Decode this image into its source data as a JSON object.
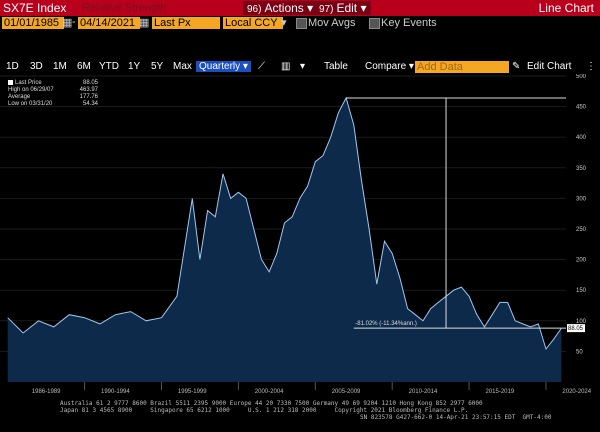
{
  "header": {
    "ticker": "SX7E Index",
    "hidden_tag": "Relative Strength",
    "actions_num": "96)",
    "actions_label": "Actions",
    "edit_num": "97)",
    "edit_label": "Edit",
    "title": "Line Chart"
  },
  "controls": {
    "start_date": "01/01/1985",
    "end_date": "04/14/2021",
    "price_field": "Last Px",
    "currency": "Local CCY",
    "mov_avgs": "Mov Avgs",
    "key_events": "Key Events"
  },
  "toolbar": {
    "ranges": [
      "1D",
      "3D",
      "1M",
      "6M",
      "YTD",
      "1Y",
      "5Y",
      "Max"
    ],
    "frequency": "Quarterly",
    "table": "Table",
    "compare": "Compare",
    "add_data": "Add Data",
    "edit_chart": "Edit Chart"
  },
  "legend": {
    "last_price_label": "Last Price",
    "last_price": "88.05",
    "high_label": "High on 06/29/07",
    "high": "463.97",
    "avg_label": "Average",
    "avg": "177.76",
    "low_label": "Low on 03/31/20",
    "low": "54.34"
  },
  "annotation": "-81.02% (-11.34%ann.)",
  "last_value_tag": "88.05",
  "chart_data": {
    "type": "area",
    "series": [
      {
        "name": "Last Price",
        "x": [
          "1985",
          "1986",
          "1987",
          "1988",
          "1989",
          "1990",
          "1991",
          "1992",
          "1993",
          "1994",
          "1995",
          "1996",
          "1997",
          "1997.5",
          "1998",
          "1998.5",
          "1999",
          "1999.5",
          "2000",
          "2000.5",
          "2001",
          "2001.5",
          "2002",
          "2002.5",
          "2003",
          "2003.5",
          "2004",
          "2004.5",
          "2005",
          "2005.5",
          "2006",
          "2006.5",
          "2007",
          "2007.5",
          "2008",
          "2008.5",
          "2009",
          "2009.5",
          "2010",
          "2010.5",
          "2011",
          "2011.5",
          "2012",
          "2012.5",
          "2013",
          "2013.5",
          "2014",
          "2014.5",
          "2015",
          "2015.5",
          "2016",
          "2016.5",
          "2017",
          "2017.5",
          "2018",
          "2018.5",
          "2019",
          "2019.5",
          "2020",
          "2020.5",
          "2021"
        ],
        "values": [
          105,
          80,
          100,
          90,
          110,
          105,
          95,
          110,
          115,
          100,
          105,
          140,
          300,
          200,
          280,
          270,
          340,
          300,
          310,
          300,
          250,
          200,
          180,
          210,
          260,
          270,
          300,
          320,
          360,
          370,
          400,
          440,
          464,
          420,
          330,
          250,
          160,
          230,
          210,
          170,
          120,
          110,
          100,
          120,
          130,
          140,
          150,
          155,
          140,
          110,
          90,
          110,
          130,
          130,
          100,
          95,
          90,
          95,
          54,
          70,
          88
        ]
      }
    ],
    "xlabel": "",
    "ylabel": "",
    "ylim": [
      0,
      500
    ],
    "yticks": [
      50,
      100,
      150,
      200,
      250,
      300,
      350,
      400,
      450,
      500
    ],
    "xtick_labels": [
      "1986-1989",
      "1990-1994",
      "1995-1999",
      "2000-2004",
      "2005-2009",
      "2010-2014",
      "2015-2019",
      "2020-2024"
    ],
    "high_value": 463.97,
    "last_value": 88.05,
    "grid": true,
    "colors": {
      "fill": "#0d2a4a",
      "line": "#9ec7f0",
      "marker": "#ffffff"
    }
  }
}
